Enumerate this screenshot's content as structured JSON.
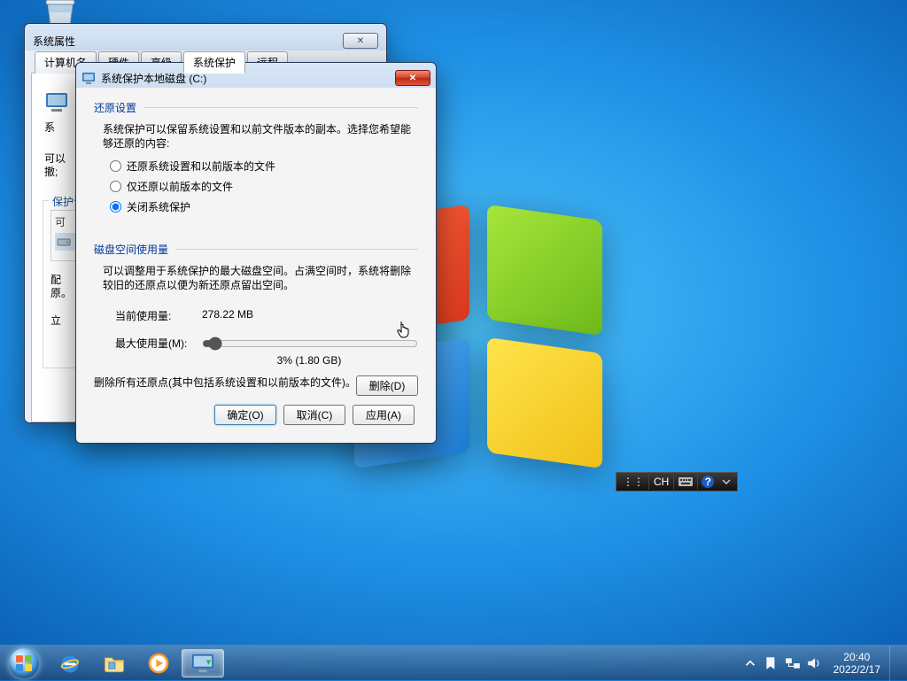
{
  "recycle_bin_label": "",
  "parent_window": {
    "title": "系统属性",
    "tabs": [
      "计算机名",
      "硬件",
      "高级",
      "系统保护",
      "远程"
    ],
    "body_peek_lines": [
      "系",
      "可以",
      "撤;"
    ],
    "protection_group_label": "保护设",
    "col_header_drive": "可",
    "configure_label_l1": "配",
    "configure_label_l2": "原。",
    "create_label": "立"
  },
  "dialog": {
    "title": "系统保护本地磁盘 (C:)",
    "restore": {
      "header": "还原设置",
      "desc": "系统保护可以保留系统设置和以前文件版本的副本。选择您希望能够还原的内容:",
      "opt1": "还原系统设置和以前版本的文件",
      "opt2": "仅还原以前版本的文件",
      "opt3": "关闭系统保护"
    },
    "disk": {
      "header": "磁盘空间使用量",
      "desc": "可以调整用于系统保护的最大磁盘空间。占满空间时，系统将删除较旧的还原点以便为新还原点留出空间。",
      "current_label": "当前使用量:",
      "current_value": "278.22 MB",
      "max_label": "最大使用量(M):",
      "slider_text": "3% (1.80 GB)",
      "delete_desc": "删除所有还原点(其中包括系统设置和以前版本的文件)。",
      "delete_btn": "删除(D)"
    },
    "buttons": {
      "ok": "确定(O)",
      "cancel": "取消(C)",
      "apply": "应用(A)"
    }
  },
  "ime": {
    "lang": "CH"
  },
  "clock": {
    "time": "20:40",
    "date": "2022/2/17"
  }
}
